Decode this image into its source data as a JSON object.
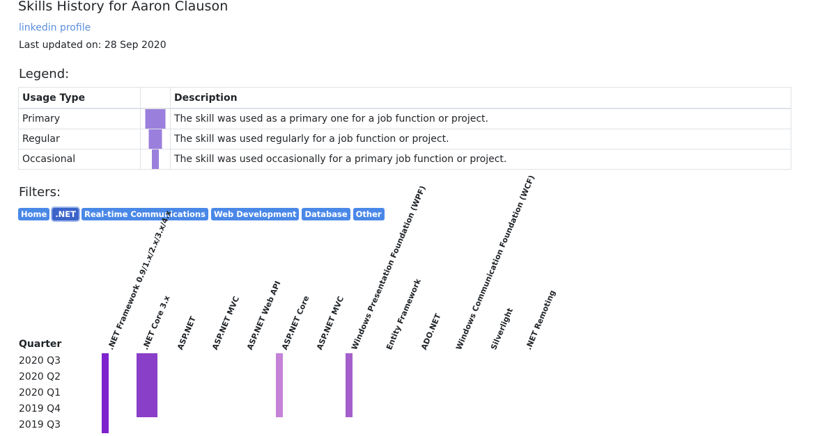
{
  "header": {
    "title": "Skills History for Aaron Clauson",
    "profile_link": "linkedin profile",
    "last_updated": "Last updated on: 28 Sep 2020"
  },
  "legend": {
    "heading": "Legend:",
    "columns": [
      "Usage Type",
      "",
      "Description"
    ],
    "rows": [
      {
        "type": "Primary",
        "description": "The skill was used as a primary one for a job function or project.",
        "level": 1.0
      },
      {
        "type": "Regular",
        "description": "The skill was used regularly for a job function or project.",
        "level": 0.67
      },
      {
        "type": "Occasional",
        "description": "The skill was used occasionally for a primary job function or project.",
        "level": 0.33
      }
    ],
    "bar_color": "#9b7fdc"
  },
  "filters": {
    "heading": "Filters:",
    "items": [
      "Home",
      ".NET",
      "Real-time Communications",
      "Web Development",
      "Database",
      "Other"
    ],
    "active": ".NET",
    "color": "#4a88e8",
    "active_color": "#3b63c9"
  },
  "timeline": {
    "quarter_header": "Quarter",
    "quarters": [
      "2020 Q3",
      "2020 Q2",
      "2020 Q1",
      "2019 Q4",
      "2019 Q3"
    ],
    "skills": [
      ".NET Framework 0.9/1.x/2.x/3.x/4.x",
      ".NET Core 3.x",
      "ASP.NET",
      "ASP.NET MVC",
      "ASP.NET Web API",
      "ASP.NET Core",
      "ASP.NET MVC",
      "Windows Presentation Foundation (WPF)",
      "Entity Framework",
      "ADO.NET",
      "Windows Communication Foundation (WCF)",
      "Silverlight",
      ".NET Remoting"
    ],
    "usage": [
      {
        "skill": 0,
        "from": 0,
        "to": 4,
        "level": "Occasional",
        "color": "#7e22ce"
      },
      {
        "skill": 1,
        "from": 0,
        "to": 3,
        "level": "Primary",
        "color": "#8a3fc9"
      },
      {
        "skill": 5,
        "from": 0,
        "to": 3,
        "level": "Occasional",
        "color": "#c483d6"
      },
      {
        "skill": 7,
        "from": 0,
        "to": 3,
        "level": "Occasional",
        "color": "#a55fcc"
      }
    ]
  }
}
